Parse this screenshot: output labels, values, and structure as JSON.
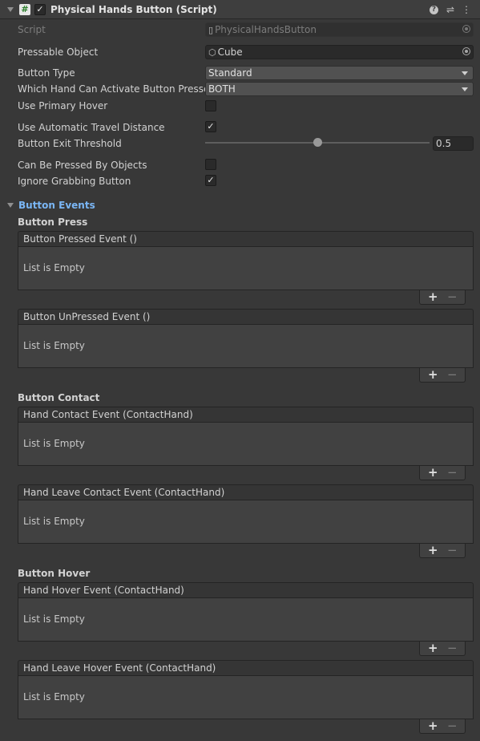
{
  "component": {
    "title": "Physical Hands Button (Script)",
    "script_icon": "#",
    "enabled_check": "✓",
    "help_icon": "?",
    "settings_icon": "⇌",
    "menu_icon": "⋮"
  },
  "properties": {
    "script_label": "Script",
    "script_value": "PhysicalHandsButton",
    "pressable_label": "Pressable Object",
    "pressable_value": "Cube",
    "button_type_label": "Button Type",
    "button_type_value": "Standard",
    "which_hand_label": "Which Hand Can Activate Button Presses",
    "which_hand_value": "BOTH",
    "use_primary_hover_label": "Use Primary Hover",
    "use_primary_hover_check": "",
    "use_auto_travel_label": "Use Automatic Travel Distance",
    "use_auto_travel_check": "✓",
    "exit_threshold_label": "Button Exit Threshold",
    "exit_threshold_value": "0.5",
    "exit_threshold_fraction": 0.5,
    "pressed_by_objects_label": "Can Be Pressed By Objects",
    "pressed_by_objects_check": "",
    "ignore_grabbing_label": "Ignore Grabbing Button",
    "ignore_grabbing_check": "✓"
  },
  "events": {
    "section_title": "Button Events",
    "press_title": "Button Press",
    "contact_title": "Button Contact",
    "hover_title": "Button Hover",
    "empty_text": "List is Empty",
    "plus": "+",
    "minus": "−",
    "items": [
      {
        "name": "Button Pressed Event ()"
      },
      {
        "name": "Button UnPressed Event ()"
      },
      {
        "name": "Hand Contact Event (ContactHand)"
      },
      {
        "name": "Hand Leave Contact Event (ContactHand)"
      },
      {
        "name": "Hand Hover Event (ContactHand)"
      },
      {
        "name": "Hand Leave Hover Event (ContactHand)"
      }
    ]
  },
  "colors": {
    "background": "#383838",
    "section_title": "#7ab6f5",
    "field_bg": "#2a2a2a"
  }
}
